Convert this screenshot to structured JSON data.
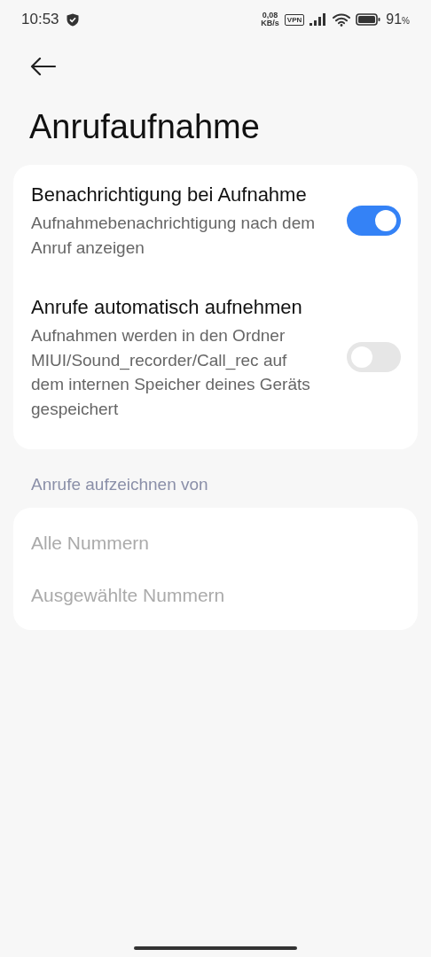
{
  "status_bar": {
    "time": "10:53",
    "speed_value": "0,08",
    "speed_unit": "KB/s",
    "vpn": "VPN",
    "battery": "91",
    "battery_unit": "%"
  },
  "title": "Anrufaufnahme",
  "settings": [
    {
      "title": "Benachrichtigung bei Aufnahme",
      "description": "Aufnahmebenachrichtigung nach dem Anruf anzeigen",
      "on": true
    },
    {
      "title": "Anrufe automatisch aufnehmen",
      "description": "Aufnahmen werden in den Ordner MIUI/Sound_recorder/Call_rec auf dem internen Speicher deines Geräts gespeichert",
      "on": false
    }
  ],
  "section": {
    "header": "Anrufe aufzeichnen von",
    "options": [
      {
        "label": "Alle Nummern",
        "disabled": true
      },
      {
        "label": "Ausgewählte Nummern",
        "disabled": true
      }
    ]
  }
}
